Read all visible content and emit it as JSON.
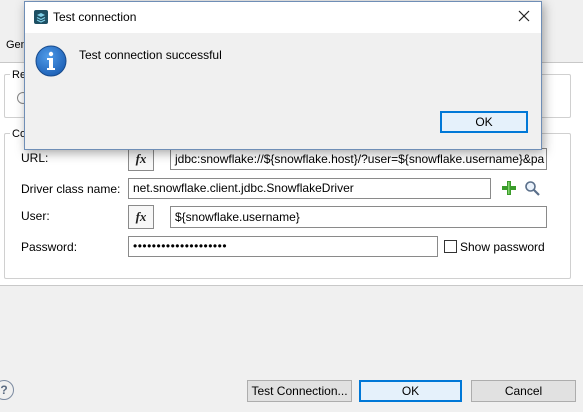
{
  "background_dialog": {
    "tab_label": "Gen",
    "group_top_title": "Re",
    "group_conn_title": "Co",
    "url_label": "URL:",
    "url_value": "jdbc:snowflake://${snowflake.host}/?user=${snowflake.username}&pa",
    "driver_label": "Driver class name:",
    "driver_value": "net.snowflake.client.jdbc.SnowflakeDriver",
    "user_label": "User:",
    "user_value": "${snowflake.username}",
    "password_label": "Password:",
    "password_value": "••••••••••••••••••••",
    "show_password_label": "Show password",
    "fx_label": "fx",
    "help_glyph": "?",
    "buttons": {
      "test_connection": "Test Connection...",
      "ok": "OK",
      "cancel": "Cancel"
    }
  },
  "modal": {
    "title": "Test connection",
    "message": "Test connection successful",
    "ok": "OK"
  },
  "icons": {
    "add": "plus-icon",
    "search": "magnifier-icon",
    "info": "info-icon",
    "close": "close-icon",
    "app": "app-icon"
  },
  "colors": {
    "accent": "#0078d7",
    "info_blue": "#1c5fb5",
    "add_green": "#3a9b2a"
  }
}
